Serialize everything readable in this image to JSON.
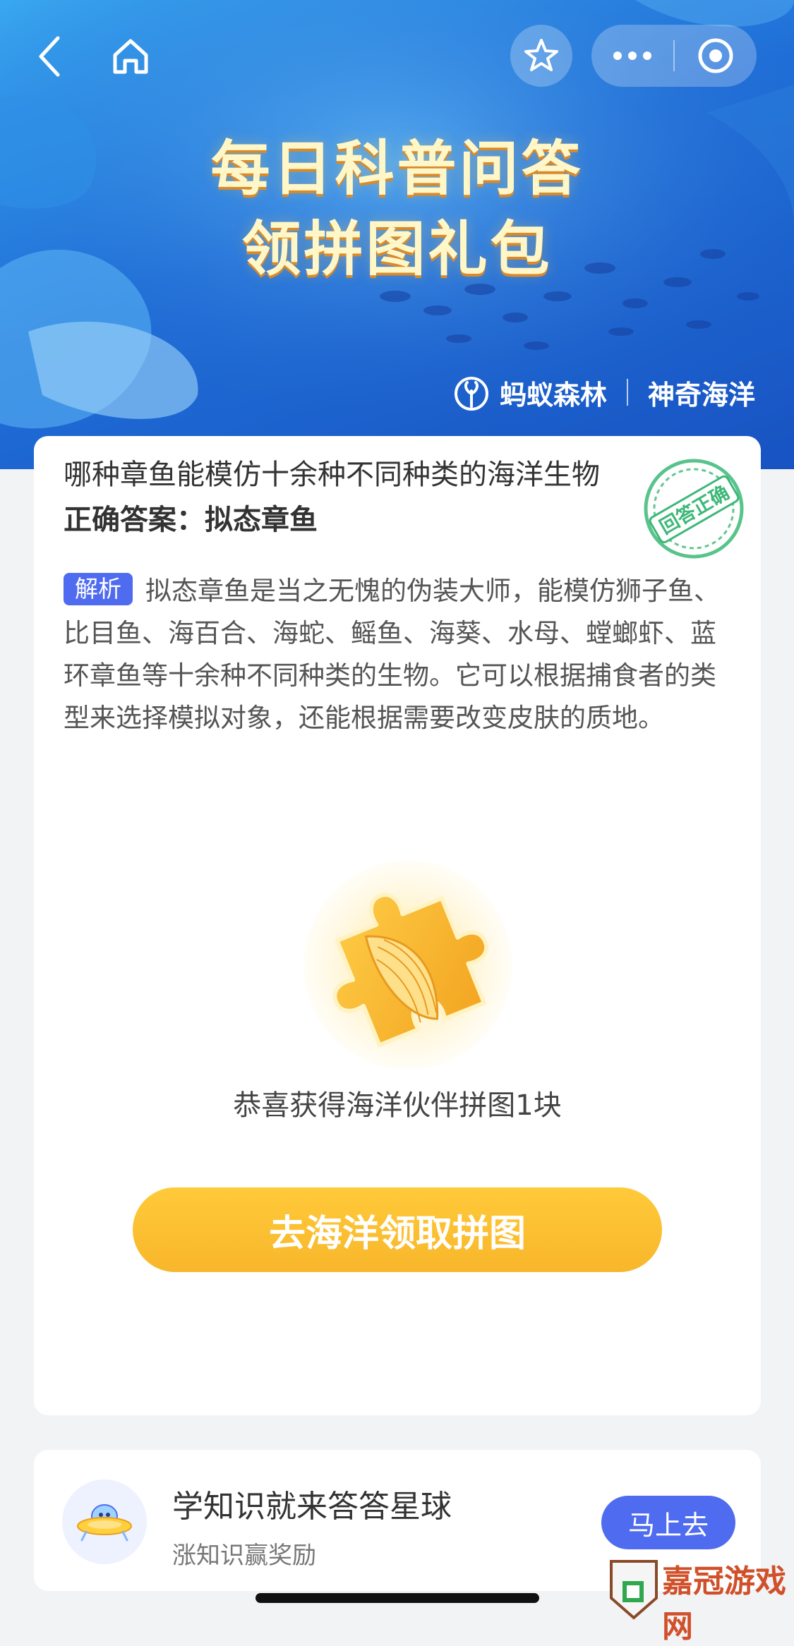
{
  "header": {
    "title_line1": "每日科普问答",
    "title_line2": "领拼图礼包",
    "brand_left": "蚂蚁森林",
    "brand_right": "神奇海洋"
  },
  "nav": {
    "icons": [
      "back-arrow-icon",
      "home-icon",
      "star-icon",
      "more-dots-icon",
      "target-close-icon"
    ]
  },
  "quiz": {
    "question": "哪种章鱼能模仿十余种不同种类的海洋生物",
    "answer": "正确答案：拟态章鱼",
    "stamp_text": "回答正确",
    "analysis_tag": "解析",
    "analysis_text": "拟态章鱼是当之无愧的伪装大师，能模仿狮子鱼、比目鱼、海百合、海蛇、鳐鱼、海葵、水母、螳螂虾、蓝环章鱼等十余种不同种类的生物。它可以根据捕食者的类型来选择模拟对象，还能根据需要改变皮肤的质地。"
  },
  "reward": {
    "text": "恭喜获得海洋伙伴拼图1块",
    "cta_label": "去海洋领取拼图"
  },
  "promo": {
    "title": "学知识就来答答星球",
    "subtitle": "涨知识赢奖励",
    "button_label": "马上去"
  },
  "watermark": {
    "text": "嘉冠游戏网"
  },
  "colors": {
    "banner_blue": "#1f6fd8",
    "accent_blue": "#4f6bef",
    "cta_yellow": "#f8b62b",
    "stamp_green": "#3cb878"
  }
}
